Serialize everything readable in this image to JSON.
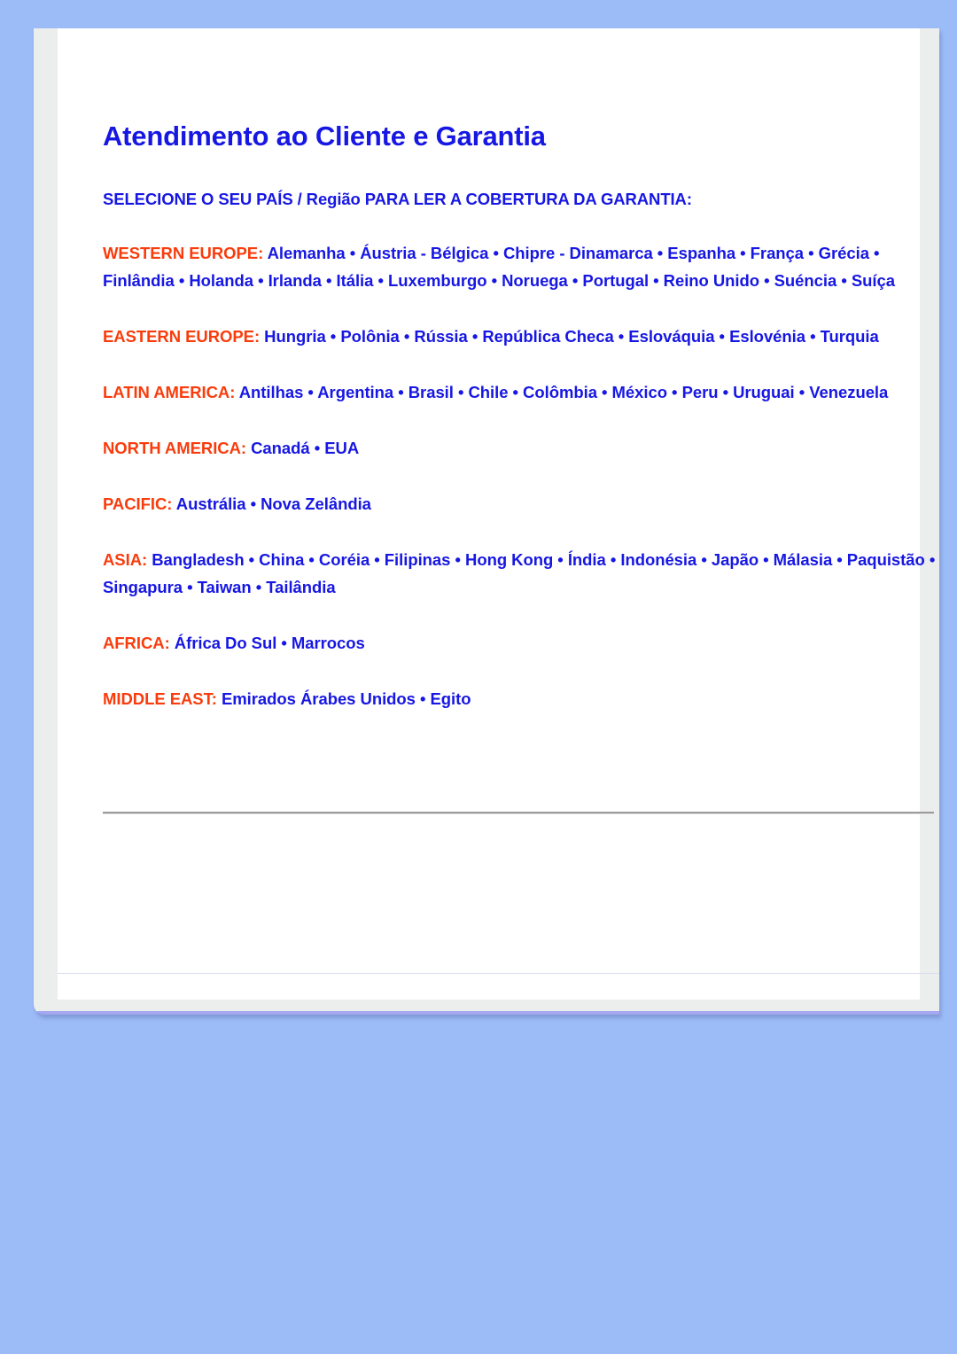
{
  "page": {
    "title": "Atendimento ao Cliente e Garantia",
    "select_prompt": "SELECIONE O SEU PAÍS / Região PARA LER A COBERTURA DA GARANTIA:",
    "colors": {
      "background": "#9cbcf7",
      "sheet": "#ffffff",
      "gutter": "#eceded",
      "heading_blue": "#1717e3",
      "region_label_orange": "#f93c0c",
      "divider": "#9a9a9a"
    }
  },
  "regions": [
    {
      "label": "WESTERN EUROPE:",
      "countries": " Alemanha • Áustria - Bélgica • Chipre - Dinamarca • Espanha • França • Grécia • Finlândia • Holanda • Irlanda • Itália • Luxemburgo • Noruega • Portugal • Reino Unido • Suéncia • Suíça"
    },
    {
      "label": "EASTERN EUROPE:",
      "countries": " Hungria • Polônia • Rússia • República Checa • Eslováquia • Eslovénia • Turquia"
    },
    {
      "label": "LATIN AMERICA:",
      "countries": " Antilhas • Argentina • Brasil • Chile • Colômbia • México • Peru • Uruguai • Venezuela"
    },
    {
      "label": "NORTH AMERICA:",
      "countries": " Canadá • EUA"
    },
    {
      "label": "PACIFIC:",
      "countries": " Austrália • Nova Zelândia"
    },
    {
      "label": "ASIA:",
      "countries": " Bangladesh • China • Coréia • Filipinas • Hong Kong • Índia • Indonésia • Japão • Málasia • Paquistão • Singapura • Taiwan • Tailândia"
    },
    {
      "label": "AFRICA:",
      "countries": " África Do Sul • Marrocos"
    },
    {
      "label": "MIDDLE EAST:",
      "countries": " Emirados Árabes Unidos • Egito"
    }
  ]
}
